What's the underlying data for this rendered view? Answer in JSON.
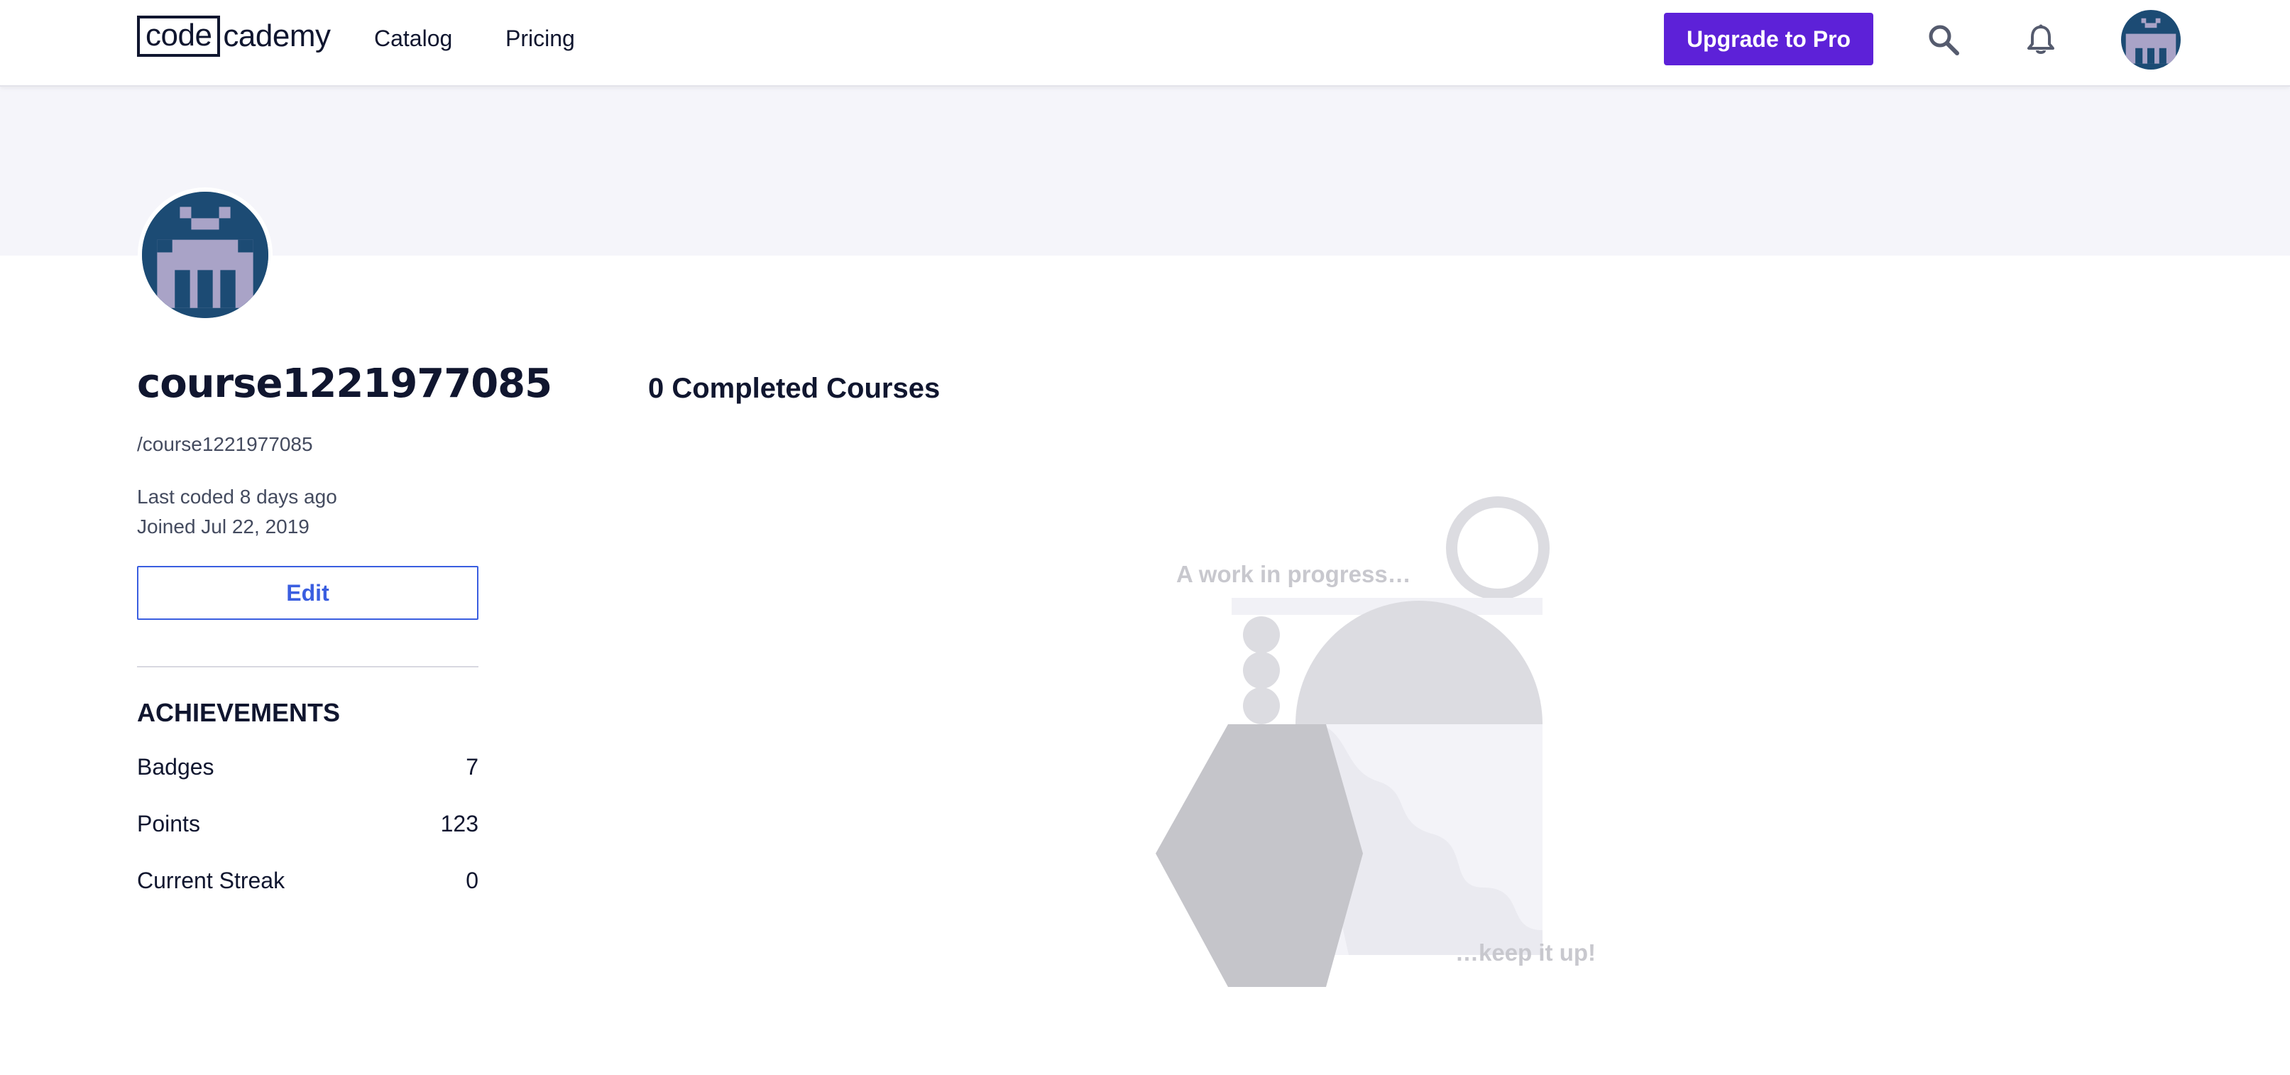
{
  "header": {
    "logo_box": "code",
    "logo_rest": "cademy",
    "nav": [
      {
        "label": "Catalog"
      },
      {
        "label": "Pricing"
      }
    ],
    "upgrade_label": "Upgrade to Pro",
    "icons": [
      "search-icon",
      "bell-icon"
    ]
  },
  "profile": {
    "username": "course1221977085",
    "handle": "/course1221977085",
    "last_coded": "Last coded 8 days ago",
    "joined": "Joined Jul 22, 2019",
    "edit_label": "Edit",
    "avatar_colors": {
      "background": "#1c4b74",
      "figure": "#a9a3c7"
    }
  },
  "achievements": {
    "title": "ACHIEVEMENTS",
    "items": [
      {
        "label": "Badges",
        "value": "7"
      },
      {
        "label": "Points",
        "value": "123"
      },
      {
        "label": "Current Streak",
        "value": "0"
      }
    ]
  },
  "main": {
    "completed_title": "0 Completed Courses",
    "illustration": {
      "top_text": "A work in progress…",
      "bottom_text": "…keep it up!"
    }
  },
  "colors": {
    "accent": "#5d21d8",
    "link": "#3a5ee0",
    "banner": "#f5f5fa",
    "text": "#10162f"
  }
}
